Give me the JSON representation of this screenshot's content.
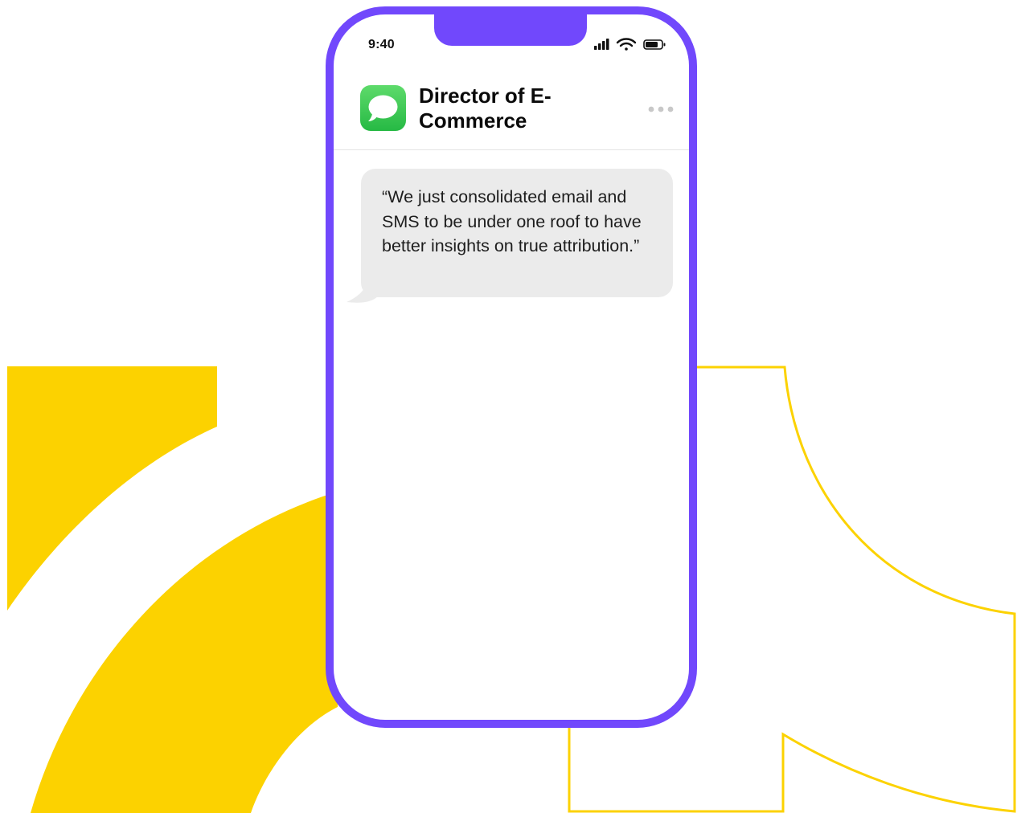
{
  "status_bar": {
    "time": "9:40",
    "icons": [
      "cellular-signal-icon",
      "wifi-icon",
      "battery-icon"
    ]
  },
  "conversation": {
    "app_icon": "messages-app-icon",
    "contact_name": "Director of E-Commerce",
    "more_icon": "ellipsis-icon"
  },
  "messages": [
    {
      "direction": "incoming",
      "text": "“We just consolidated email and SMS to be under one roof to have better insights on true attribution.”"
    }
  ],
  "colors": {
    "phone_frame": "#7148FC",
    "accent_yellow": "#FCD200",
    "bubble_incoming": "#EBEBEB",
    "messages_green": "#34C759"
  }
}
